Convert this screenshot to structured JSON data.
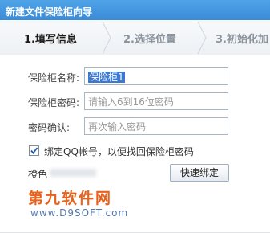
{
  "window": {
    "title": "新建文件保险柜向导"
  },
  "steps": [
    {
      "label": "1.填写信息",
      "active": true
    },
    {
      "label": "2.选择位置",
      "active": false
    },
    {
      "label": "3.初始化加",
      "active": false
    }
  ],
  "form": {
    "name": {
      "label": "保险柜名称:",
      "value": "保险柜1"
    },
    "password": {
      "label": "保险柜密码:",
      "placeholder": "请输入6到16位密码"
    },
    "confirm": {
      "label": "密码确认:",
      "placeholder": "再次输入密码"
    }
  },
  "bind_qq": {
    "checked": true,
    "label": "绑定QQ帐号，以便找回保险柜密码"
  },
  "account": {
    "label": "橙色"
  },
  "quick_bind_button": "快速绑定",
  "watermark": {
    "title": "第九软件网",
    "url": "www.D9SOFT.com"
  },
  "colors": {
    "titlebar": "#3b8bd8",
    "selection": "#3a78d6",
    "watermark": "#e8621b"
  }
}
